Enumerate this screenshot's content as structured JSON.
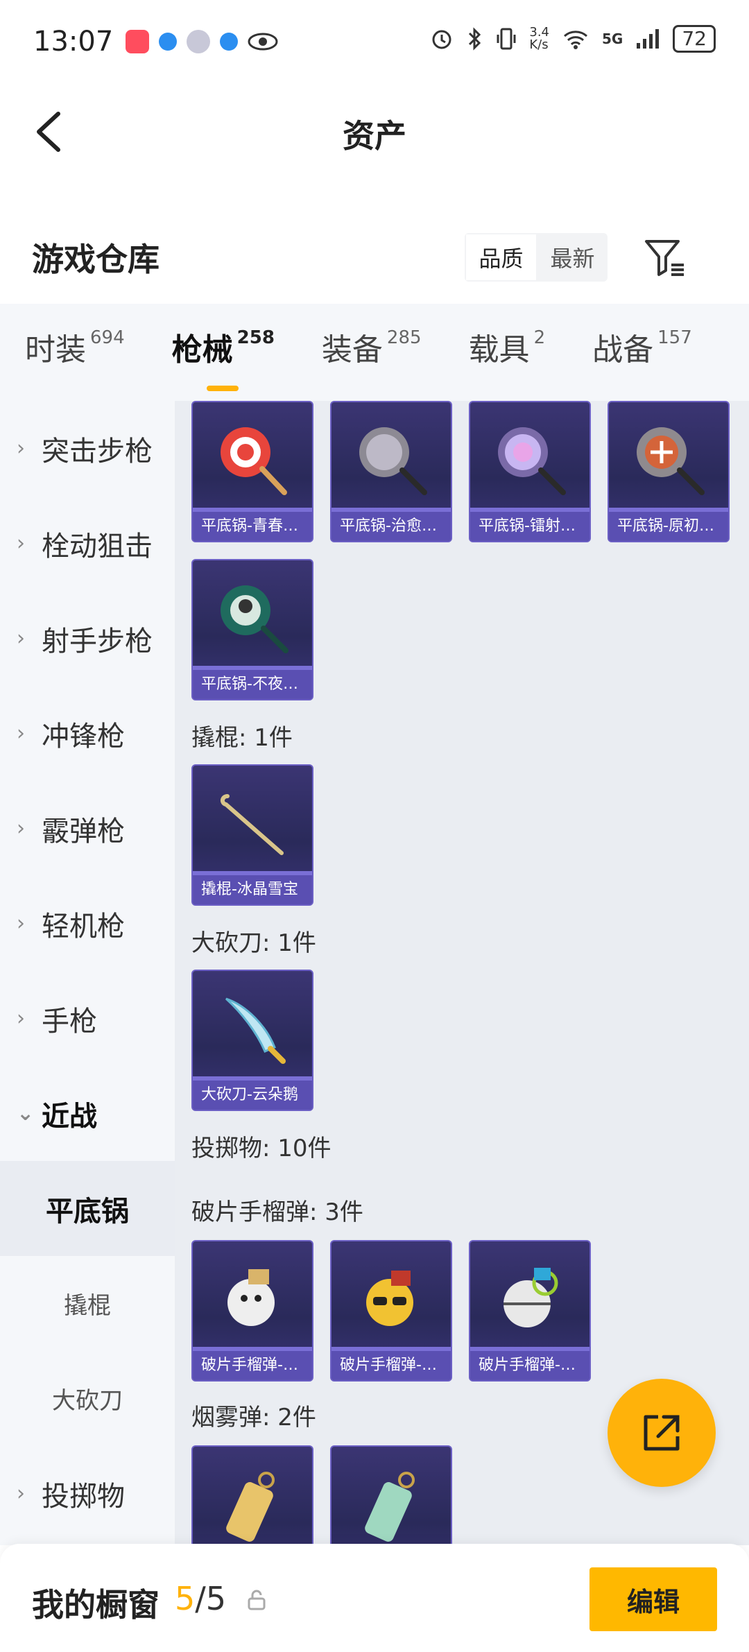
{
  "status_bar": {
    "time": "13:07",
    "net_speed": "3.4\nK/s",
    "network": "5G",
    "battery": "72"
  },
  "nav": {
    "title": "资产"
  },
  "header": {
    "title": "游戏仓库",
    "sort_options": [
      "品质",
      "最新"
    ],
    "active_sort": "品质"
  },
  "tabs": [
    {
      "label": "时装",
      "count": "694"
    },
    {
      "label": "枪械",
      "count": "258"
    },
    {
      "label": "装备",
      "count": "285"
    },
    {
      "label": "载具",
      "count": "2"
    },
    {
      "label": "战备",
      "count": "157"
    }
  ],
  "sidebar": {
    "items": [
      {
        "label": "突击步枪"
      },
      {
        "label": "栓动狙击"
      },
      {
        "label": "射手步枪"
      },
      {
        "label": "冲锋枪"
      },
      {
        "label": "霰弹枪"
      },
      {
        "label": "轻机枪"
      },
      {
        "label": "手枪"
      },
      {
        "label": "近战"
      }
    ],
    "subitems": [
      {
        "label": "平底锅"
      },
      {
        "label": "撬棍"
      },
      {
        "label": "大砍刀"
      }
    ],
    "last_item": {
      "label": "投掷物"
    }
  },
  "content": {
    "pans": [
      "平底锅-青春…",
      "平底锅-治愈…",
      "平底锅-镭射…",
      "平底锅-原初…",
      "平底锅-不夜…"
    ],
    "crowbar_group": "撬棍: 1件",
    "crowbar": [
      "撬棍-冰晶雪宝"
    ],
    "machete_group": "大砍刀: 1件",
    "machete": [
      "大砍刀-云朵鹅"
    ],
    "throwables_group": "投掷物: 10件",
    "frag_group": "破片手榴弹: 3件",
    "frags": [
      "破片手榴弹-…",
      "破片手榴弹-…",
      "破片手榴弹-…"
    ],
    "smoke_group": "烟雾弹: 2件"
  },
  "bottom": {
    "title": "我的橱窗",
    "current": "5",
    "separator": "/",
    "total": "5",
    "edit_label": "编辑"
  },
  "colors": {
    "accent": "#ffb20a",
    "card_bg": "#2f2b63",
    "card_label": "#5a4fb2"
  }
}
